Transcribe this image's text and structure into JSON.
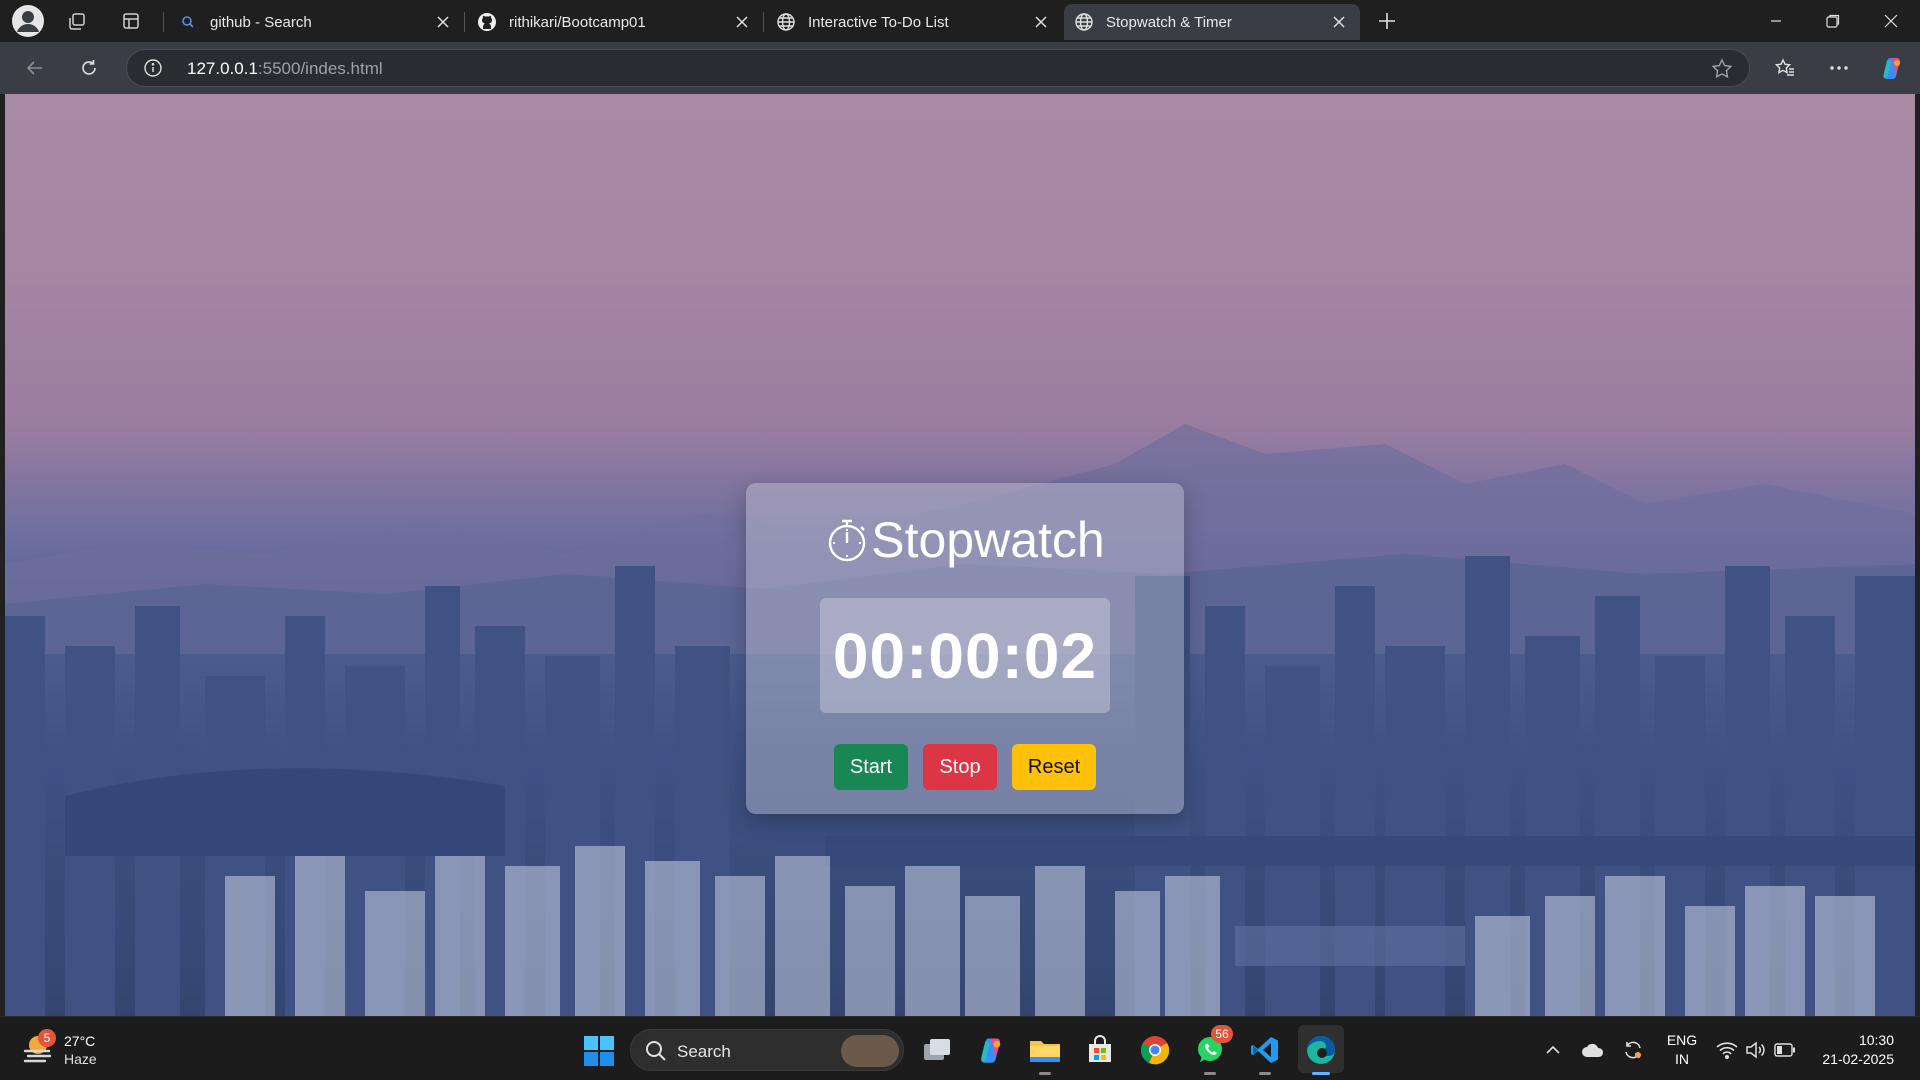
{
  "browser": {
    "tabs": [
      {
        "title": "github - Search",
        "active": false
      },
      {
        "title": "rithikari/Bootcamp01",
        "active": false
      },
      {
        "title": "Interactive To-Do List",
        "active": false
      },
      {
        "title": "Stopwatch & Timer",
        "active": true
      }
    ],
    "url_host": "127.0.0.1",
    "url_rest": ":5500/indes.html"
  },
  "page": {
    "title": "Stopwatch",
    "time": "00:00:02",
    "buttons": {
      "start": "Start",
      "stop": "Stop",
      "reset": "Reset"
    },
    "colors": {
      "start": "#198754",
      "stop": "#dc3545",
      "reset": "#ffc107"
    }
  },
  "taskbar": {
    "weather": {
      "temp": "27°C",
      "condition": "Haze",
      "badge": "5"
    },
    "search_label": "Search",
    "whatsapp_badge": "56",
    "lang_line1": "ENG",
    "lang_line2": "IN",
    "time": "10:30",
    "date": "21-02-2025"
  }
}
